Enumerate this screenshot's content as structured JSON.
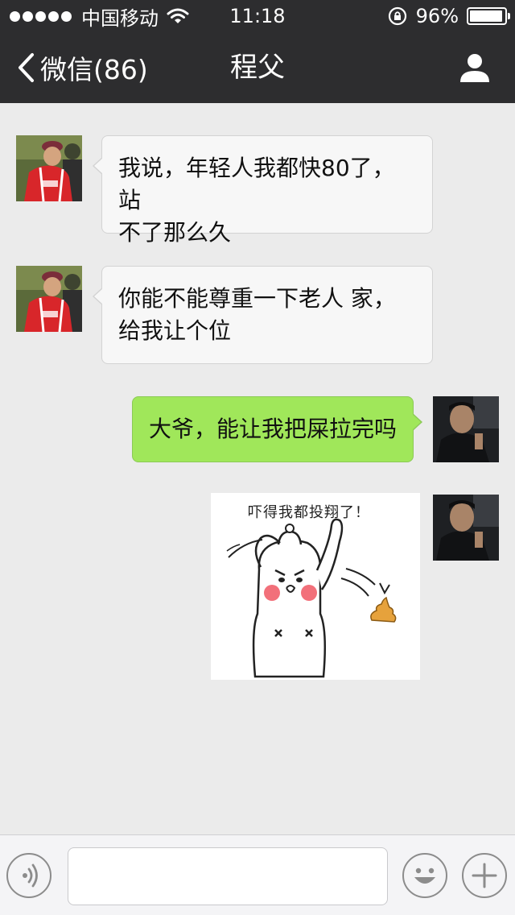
{
  "status_bar": {
    "carrier": "中国移动",
    "time": "11:18",
    "battery": "96%",
    "battery_level": 0.96,
    "signal_bars": 5
  },
  "nav": {
    "back_label": "微信(86)",
    "title": "程父"
  },
  "messages": [
    {
      "side": "left",
      "sender": "old-man",
      "text_line1": "我说，年轻人我都快80了，站",
      "text_line2": "不了那么久"
    },
    {
      "side": "left",
      "sender": "old-man",
      "text_line1": "你能不能尊重一下老人 家，",
      "text_line2": "给我让个位"
    },
    {
      "side": "right",
      "sender": "me",
      "text": "大爷，能让我把屎拉完吗"
    },
    {
      "side": "right",
      "sender": "me",
      "sticker_caption": "吓得我都投翔了！"
    }
  ],
  "input_bar": {
    "voice_icon": "voice-icon",
    "emoji_icon": "emoji-icon",
    "plus_icon": "plus-icon",
    "input_value": ""
  },
  "colors": {
    "header_bg": "#2d2d2f",
    "chat_bg": "#ebebeb",
    "bubble_left": "#f7f7f7",
    "bubble_right": "#a0e75a"
  }
}
